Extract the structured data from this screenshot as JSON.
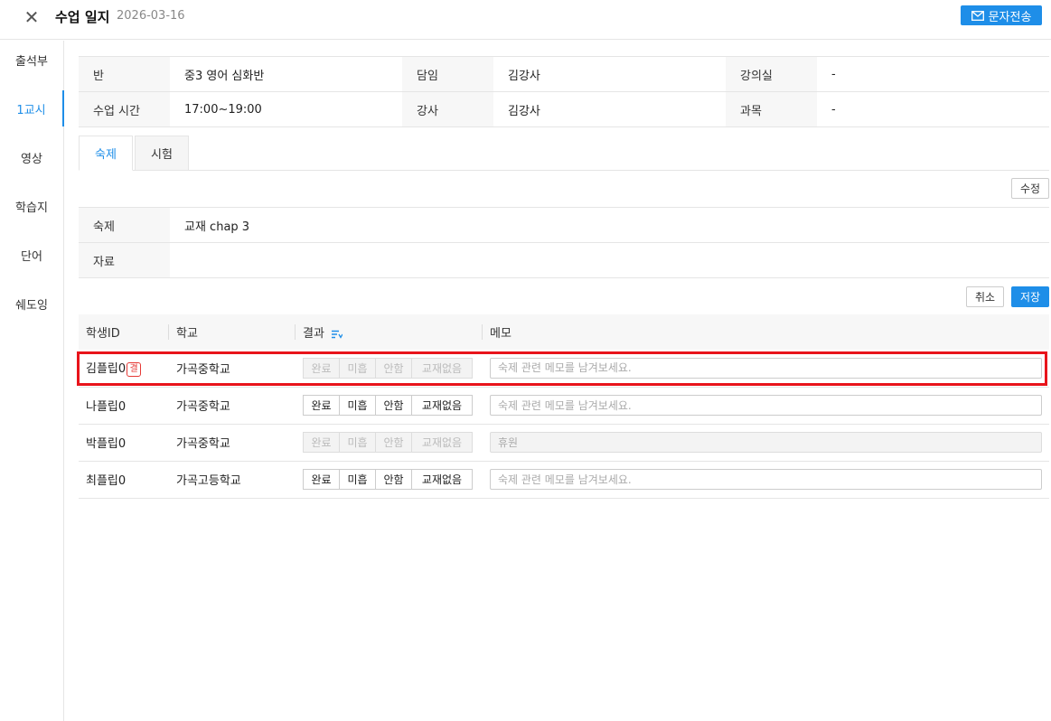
{
  "header": {
    "title": "수업 일지",
    "date": "2026-03-16",
    "sms_label": "문자전송"
  },
  "sidebar": {
    "items": [
      {
        "label": "출석부"
      },
      {
        "label": "1교시"
      },
      {
        "label": "영상"
      },
      {
        "label": "학습지"
      },
      {
        "label": "단어"
      },
      {
        "label": "쉐도잉"
      }
    ],
    "active_index": 1
  },
  "class_info": {
    "class_label": "반",
    "class_value": "중3 영어 심화반",
    "homeroom_label": "담임",
    "homeroom_value": "김강사",
    "room_label": "강의실",
    "room_value": "-",
    "time_label": "수업 시간",
    "time_value": "17:00~19:00",
    "teacher_label": "강사",
    "teacher_value": "김강사",
    "subject_label": "과목",
    "subject_value": "-"
  },
  "tabs": [
    {
      "label": "숙제",
      "active": true
    },
    {
      "label": "시험",
      "active": false
    }
  ],
  "edit_label": "수정",
  "homework": {
    "hw_label": "숙제",
    "hw_value": "교재 chap 3",
    "material_label": "자료",
    "material_value": ""
  },
  "cancel_label": "취소",
  "save_label": "저장",
  "student_table": {
    "headers": {
      "id": "학생ID",
      "school": "학교",
      "result": "결과",
      "memo": "메모"
    },
    "result_options": [
      "완료",
      "미흡",
      "안함",
      "교재없음"
    ],
    "memo_placeholder": "숙제 관련 메모를 남겨보세요.",
    "rows": [
      {
        "name": "김플립0",
        "badge": "결",
        "school": "가곡중학교",
        "disabled": true,
        "memo": ""
      },
      {
        "name": "나플립0",
        "badge": "",
        "school": "가곡중학교",
        "disabled": false,
        "memo": ""
      },
      {
        "name": "박플립0",
        "badge": "",
        "school": "가곡중학교",
        "disabled": true,
        "memo": "휴원"
      },
      {
        "name": "최플립0",
        "badge": "",
        "school": "가곡고등학교",
        "disabled": false,
        "memo": ""
      }
    ]
  },
  "colors": {
    "accent": "#1e8ee8",
    "highlight": "#e8141b",
    "absent": "#e53935"
  }
}
